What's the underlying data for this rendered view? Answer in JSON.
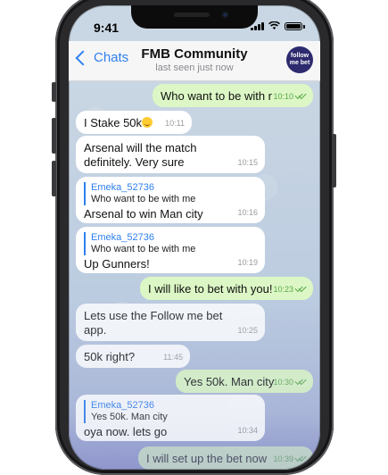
{
  "status": {
    "time": "9:41"
  },
  "header": {
    "back_label": "Chats",
    "title": "FMB Community",
    "subtitle": "last seen just now",
    "avatar_text": "follow me bet"
  },
  "messages": [
    {
      "direction": "out",
      "text": "Who want to be with r",
      "time": "10:10"
    },
    {
      "direction": "in",
      "text": "I Stake 50k",
      "time": "10:11"
    },
    {
      "direction": "in",
      "text": "Arsenal will the match definitely. Very sure",
      "time": "10:15"
    },
    {
      "direction": "in",
      "reply_author": "Emeka_52736",
      "reply_text": "Who want to be with me",
      "text": "Arsenal to win Man city",
      "time": "10:16"
    },
    {
      "direction": "in",
      "reply_author": "Emeka_52736",
      "reply_text": "Who want to be with me",
      "text": "Up Gunners!",
      "time": "10:19"
    },
    {
      "direction": "out",
      "text": "I will like to bet with you!",
      "time": "10:23"
    },
    {
      "direction": "in",
      "text": "Lets use the Follow me bet app.",
      "time": "10:25"
    },
    {
      "direction": "in",
      "text": "50k right?",
      "time": "11:45"
    },
    {
      "direction": "out",
      "text": "Yes 50k. Man city",
      "time": "10:30"
    },
    {
      "direction": "in",
      "reply_author": "Emeka_52736",
      "reply_text": "Yes 50k. Man city",
      "text": "oya now. lets go",
      "time": "10:34"
    },
    {
      "direction": "out",
      "text": "I will set up the bet now",
      "time": "10:39"
    }
  ],
  "colors": {
    "accent": "#2f80ed",
    "outgoing_bubble": "#dcf7c5",
    "incoming_bubble": "#ffffff"
  }
}
